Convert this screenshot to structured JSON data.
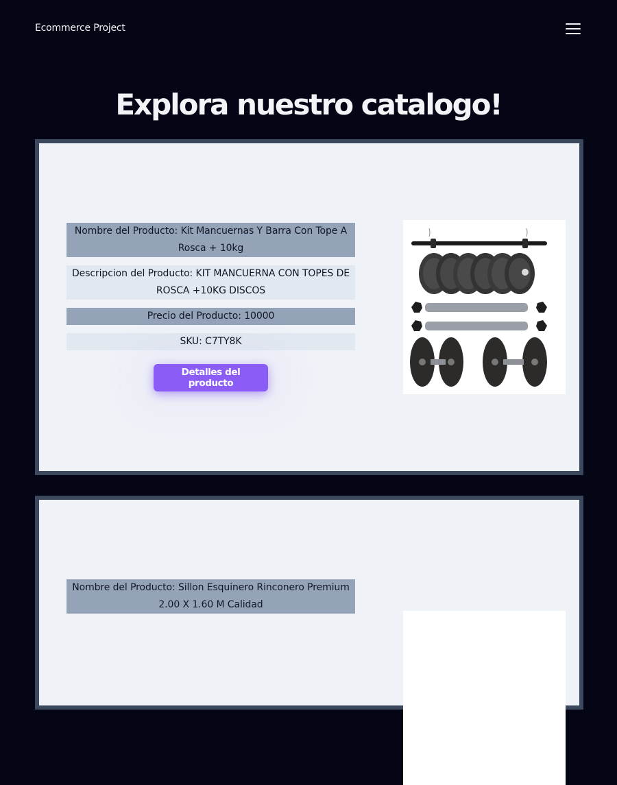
{
  "navbar": {
    "brand": "Ecommerce Project",
    "menu_icon": "hamburger-menu-icon"
  },
  "page": {
    "title": "Explora nuestro catalogo!"
  },
  "products": [
    {
      "name_line": "Nombre del Producto: Kit Mancuernas Y Barra Con Tope A Rosca + 10kg",
      "description_line": "Descripcion del Producto: KIT MANCUERNA CON TOPES DE ROSCA +10KG DISCOS",
      "price_line": "Precio del Producto: 10000",
      "sku_line": "SKU: C7TY8K",
      "button_label": "Detalles del producto",
      "image_icon": "dumbbell-kit-image"
    },
    {
      "name_line": "Nombre del Producto: Sillon Esquinero Rinconero Premium 2.00 X 1.60 M Calidad"
    }
  ],
  "colors": {
    "background": "#040615",
    "card_border": "#3c485d",
    "card_bg": "#eff2f7",
    "row_dark": "#95a3b9",
    "row_light": "#e2e8f0",
    "accent": "#8b5cf6"
  }
}
